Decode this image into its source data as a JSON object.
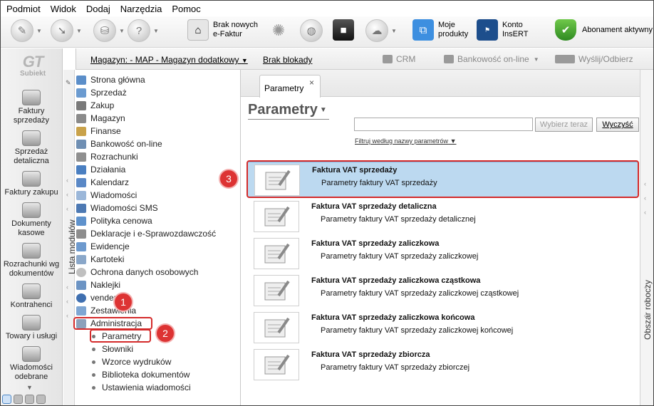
{
  "menu": [
    "Podmiot",
    "Widok",
    "Dodaj",
    "Narzędzia",
    "Pomoc"
  ],
  "toolbar": {
    "brak_efaktur": [
      "Brak nowych",
      "e-Faktur"
    ],
    "moje_produkty": [
      "Moje",
      "produkty"
    ],
    "konto_insert": [
      "Konto",
      "InsERT"
    ],
    "abonament": "Abonament aktywny"
  },
  "left_nav": {
    "logo_text": "GT",
    "logo_sub": "Subiekt",
    "items": [
      [
        "Faktury",
        "sprzedaży"
      ],
      [
        "Sprzedaż",
        "detaliczna"
      ],
      [
        "Faktury zakupu"
      ],
      [
        "Dokumenty",
        "kasowe"
      ],
      [
        "Rozrachunki wg",
        "dokumentów"
      ],
      [
        "Kontrahenci"
      ],
      [
        "Towary i usługi"
      ],
      [
        "Wiadomości",
        "odebrane"
      ]
    ]
  },
  "subbar": {
    "magazyn": "Magazyn: - MAP - Magazyn dodatkowy",
    "brak_blokady": "Brak blokady",
    "crm": "CRM",
    "bankowosc": "Bankowość on-line",
    "wyslij": "Wyślij/Odbierz"
  },
  "modules": {
    "strip_label": "Lista modułów",
    "items": [
      "Strona główna",
      "Sprzedaż",
      "Zakup",
      "Magazyn",
      "Finanse",
      "Bankowość on-line",
      "Rozrachunki",
      "Działania",
      "Kalendarz",
      "Wiadomości",
      "Wiadomości SMS",
      "Polityka cenowa",
      "Deklaracje i e-Sprawozdawczość",
      "Ewidencje",
      "Kartoteki",
      "Ochrona danych osobowych",
      "Naklejki",
      "vendero",
      "Zestawienia",
      "Administracja"
    ],
    "subitems": [
      "Parametry",
      "Słowniki",
      "Wzorce wydruków",
      "Biblioteka dokumentów",
      "Ustawienia wiadomości"
    ]
  },
  "main": {
    "tab_label": "Parametry",
    "tab_close": "×",
    "title": "Parametry",
    "search_value": "",
    "btn_choose": "Wybierz teraz",
    "btn_clear": "Wyczyść",
    "filter_label": "Filtruj według nazwy parametrów",
    "rows": [
      {
        "title": "Faktura VAT sprzedaży",
        "subtitle": "Parametry faktury VAT sprzedaży"
      },
      {
        "title": "Faktura VAT sprzedaży detaliczna",
        "subtitle": "Parametry faktury VAT sprzedaży detalicznej"
      },
      {
        "title": "Faktura VAT sprzedaży zaliczkowa",
        "subtitle": "Parametry faktury VAT sprzedaży zaliczkowej"
      },
      {
        "title": "Faktura VAT sprzedaży zaliczkowa cząstkowa",
        "subtitle": "Parametry faktury VAT sprzedaży zaliczkowej cząstkowej"
      },
      {
        "title": "Faktura VAT sprzedaży zaliczkowa końcowa",
        "subtitle": "Parametry faktury VAT sprzedaży zaliczkowej końcowej"
      },
      {
        "title": "Faktura VAT sprzedaży zbiorcza",
        "subtitle": "Parametry faktury VAT sprzedaży zbiorczej"
      }
    ]
  },
  "right_strip": {
    "label": "Obszar roboczy"
  },
  "annotations": [
    "1",
    "2",
    "3"
  ],
  "colors": {
    "selection": "#bcd9f0",
    "annotation": "#d42a2a"
  }
}
